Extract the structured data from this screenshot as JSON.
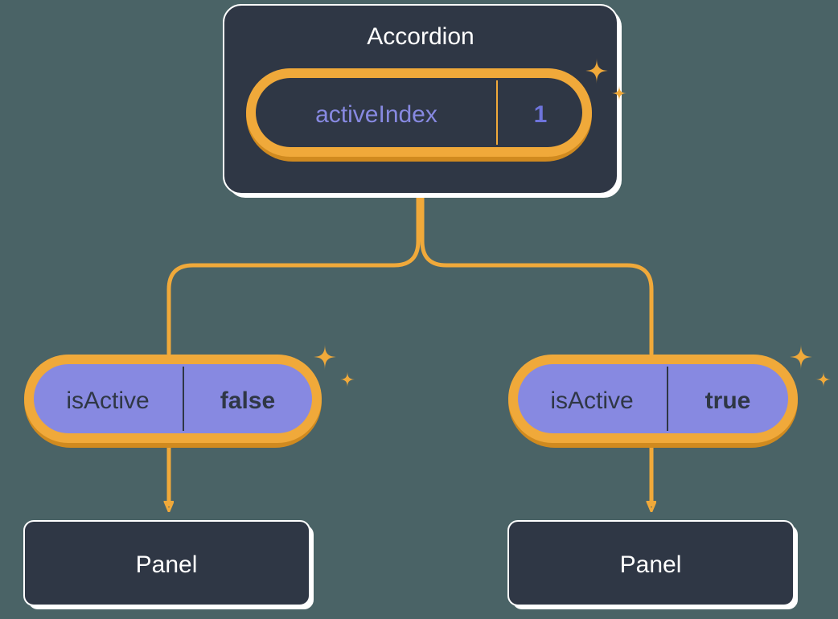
{
  "parent": {
    "title": "Accordion",
    "state": {
      "label": "activeIndex",
      "value": "1"
    }
  },
  "children": [
    {
      "prop": {
        "label": "isActive",
        "value": "false"
      },
      "title": "Panel"
    },
    {
      "prop": {
        "label": "isActive",
        "value": "true"
      },
      "title": "Panel"
    }
  ],
  "colors": {
    "bg": "#4a6366",
    "boxFill": "#2f3745",
    "boxStroke": "#ffffff",
    "accent": "#f0a93a",
    "accentDark": "#d08a1f",
    "pillLilac": "#8789e1",
    "pillLabelBlue": "#8789e1",
    "pillValueBlue": "#6e74db"
  }
}
